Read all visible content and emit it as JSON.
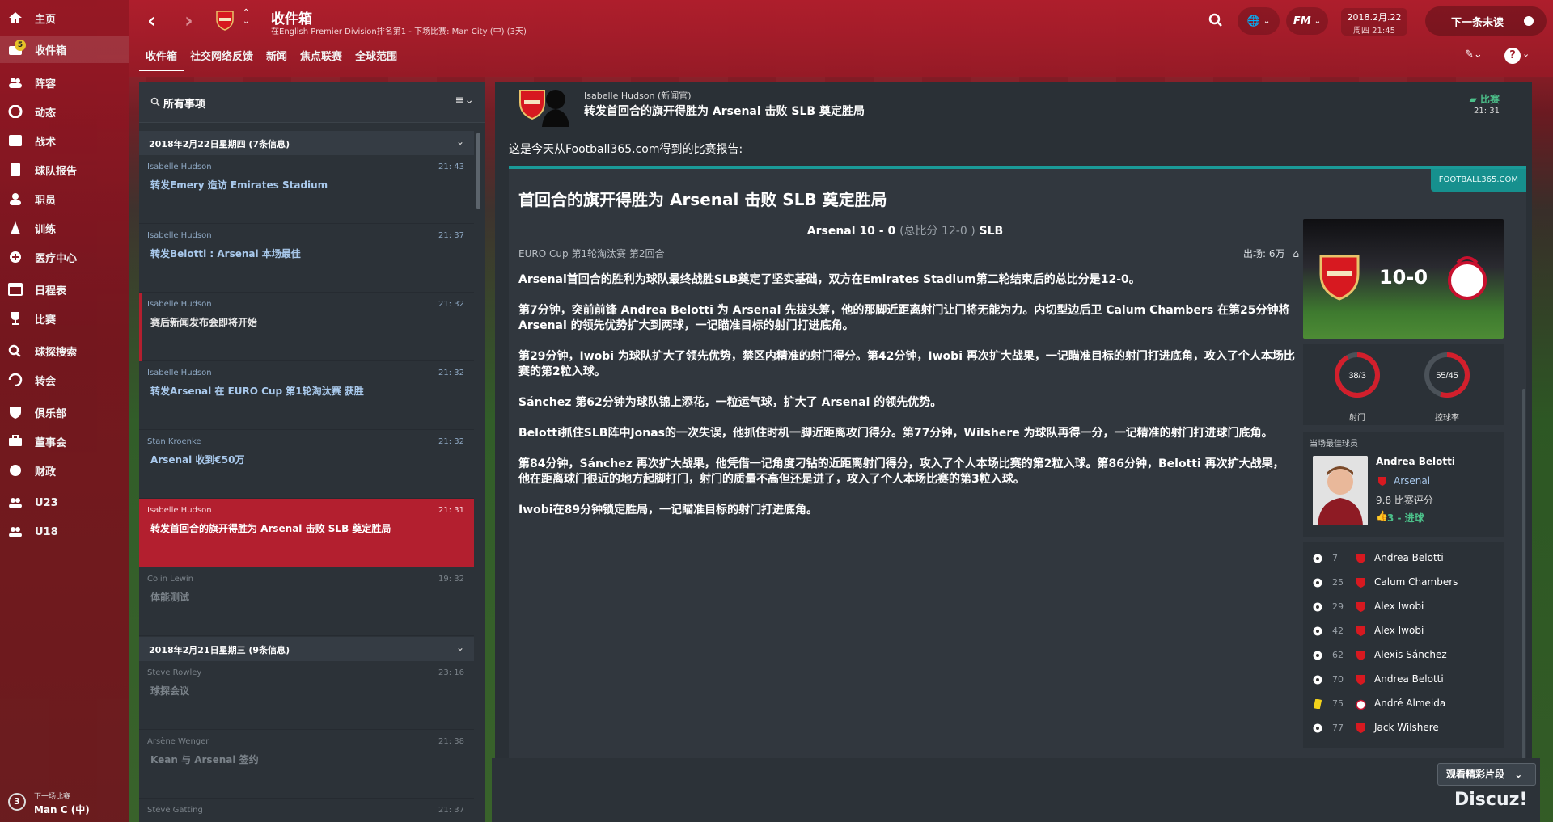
{
  "sidebar": {
    "items": [
      {
        "label": "主页",
        "icon": "home-icon"
      },
      {
        "label": "收件箱",
        "icon": "inbox-icon",
        "badge": "5"
      },
      {
        "label": "阵容",
        "icon": "squad-icon"
      },
      {
        "label": "动态",
        "icon": "dynamics-icon"
      },
      {
        "label": "战术",
        "icon": "tactics-icon"
      },
      {
        "label": "球队报告",
        "icon": "report-icon"
      },
      {
        "label": "职员",
        "icon": "staff-icon"
      },
      {
        "label": "训练",
        "icon": "training-icon"
      },
      {
        "label": "医疗中心",
        "icon": "medical-icon"
      },
      {
        "label": "日程表",
        "icon": "calendar-icon"
      },
      {
        "label": "比赛",
        "icon": "trophy-icon"
      },
      {
        "label": "球探搜索",
        "icon": "search-icon"
      },
      {
        "label": "转会",
        "icon": "transfer-icon"
      },
      {
        "label": "俱乐部",
        "icon": "club-icon"
      },
      {
        "label": "董事会",
        "icon": "board-icon"
      },
      {
        "label": "财政",
        "icon": "finance-icon"
      },
      {
        "label": "U23",
        "icon": "u23-icon"
      },
      {
        "label": "U18",
        "icon": "u18-icon"
      }
    ],
    "next_match": {
      "number": "3",
      "label": "下一场比赛",
      "value": "Man C (中)"
    }
  },
  "topbar": {
    "title": "收件箱",
    "subtitle": "在English Premier Division排名第1 - 下场比赛: Man City (中) (3天)",
    "tabs": [
      "收件箱",
      "社交网络反馈",
      "新闻",
      "焦点联赛",
      "全球范围"
    ],
    "date_line1": "2018.2月.22",
    "date_line2": "周四 21:45",
    "continue_label": "下一条未读",
    "fm_label": "FM"
  },
  "inbox": {
    "filter_title": "所有事项",
    "groups": [
      {
        "title": "2018年2月22日星期四 (7条信息)",
        "messages": [
          {
            "from": "Isabelle Hudson",
            "time": "21: 43",
            "subject": "转发Emery 造访 Emirates Stadium"
          },
          {
            "from": "Isabelle Hudson",
            "time": "21: 37",
            "subject": "转发Belotti : Arsenal 本场最佳"
          },
          {
            "from": "Isabelle Hudson",
            "time": "21: 32",
            "subject": "赛后新闻发布会即将开始"
          },
          {
            "from": "Isabelle Hudson",
            "time": "21: 32",
            "subject": "转发Arsenal 在 EURO Cup 第1轮淘汰赛 获胜"
          },
          {
            "from": "Stan Kroenke",
            "time": "21: 32",
            "subject": "Arsenal 收到€50万"
          },
          {
            "from": "Isabelle Hudson",
            "time": "21: 31",
            "subject": "转发首回合的旗开得胜为 Arsenal 击败 SLB 奠定胜局"
          },
          {
            "from": "Colin Lewin",
            "time": "19: 32",
            "subject": "体能测试"
          }
        ]
      },
      {
        "title": "2018年2月21日星期三 (9条信息)",
        "messages": [
          {
            "from": "Steve Rowley",
            "time": "23: 16",
            "subject": "球探会议"
          },
          {
            "from": "Arsène Wenger",
            "time": "21: 38",
            "subject": "Kean 与 Arsenal 签约"
          },
          {
            "from": "Steve Gatting",
            "time": "21: 37",
            "subject": ""
          }
        ]
      }
    ]
  },
  "message": {
    "from": "Isabelle Hudson (新闻官)",
    "subject": "转发首回合的旗开得胜为 Arsenal 击败 SLB 奠定胜局",
    "tag": "比赛",
    "time": "21: 31",
    "intro": "这是今天从Football365.com得到的比赛报告:"
  },
  "report": {
    "source": "FOOTBALL365.COM",
    "title": "首回合的旗开得胜为 Arsenal 击败 SLB 奠定胜局",
    "score_main": "Arsenal 10 - 0 ",
    "score_agg": "(总比分 12-0 )",
    "score_away": " SLB",
    "competition": "EURO Cup 第1轮淘汰赛 第2回合",
    "attendance": "出场: 6万",
    "paragraphs": [
      "Arsenal首回合的胜利为球队最终战胜SLB奠定了坚实基础，双方在Emirates Stadium第二轮结束后的总比分是12-0。",
      "第7分钟，突前前锋 Andrea Belotti 为 Arsenal 先拔头筹，他的那脚近距离射门让门将无能为力。内切型边后卫 Calum Chambers 在第25分钟将 Arsenal 的领先优势扩大到两球，一记瞄准目标的射门打进底角。",
      "第29分钟，Iwobi 为球队扩大了领先优势，禁区内精准的射门得分。第42分钟，Iwobi 再次扩大战果，一记瞄准目标的射门打进底角，攻入了个人本场比赛的第2粒入球。",
      "Sánchez 第62分钟为球队锦上添花，一粒运气球，扩大了 Arsenal 的领先优势。",
      "Belotti抓住SLB阵中Jonas的一次失误，他抓住时机一脚近距离攻门得分。第77分钟，Wilshere 为球队再得一分，一记精准的射门打进球门底角。",
      "第84分钟，Sánchez 再次扩大战果，他凭借一记角度刁钻的近距离射门得分，攻入了个人本场比赛的第2粒入球。第86分钟，Belotti 再次扩大战果，他在距离球门很近的地方起脚打门，射门的质量不高但还是进了，攻入了个人本场比赛的第3粒入球。",
      "Iwobi在89分钟锁定胜局，一记瞄准目标的射门打进底角。"
    ],
    "image_score": "10-0",
    "stats": [
      {
        "value": "38/3",
        "label": "射门",
        "fraction": 0.92
      },
      {
        "value": "55/45",
        "label": "控球率",
        "fraction": 0.55
      }
    ],
    "motm": {
      "heading": "当场最佳球员",
      "name": "Andrea Belotti",
      "club": "Arsenal",
      "rating": "9.8 比赛评分",
      "goals": "3 - 进球"
    },
    "events": [
      {
        "minute": "7",
        "player": "Andrea Belotti",
        "type": "goal",
        "team": "arsenal"
      },
      {
        "minute": "25",
        "player": "Calum Chambers",
        "type": "goal",
        "team": "arsenal"
      },
      {
        "minute": "29",
        "player": "Alex Iwobi",
        "type": "goal",
        "team": "arsenal"
      },
      {
        "minute": "42",
        "player": "Alex Iwobi",
        "type": "goal",
        "team": "arsenal"
      },
      {
        "minute": "62",
        "player": "Alexis Sánchez",
        "type": "goal",
        "team": "arsenal"
      },
      {
        "minute": "70",
        "player": "Andrea Belotti",
        "type": "goal",
        "team": "arsenal"
      },
      {
        "minute": "75",
        "player": "André Almeida",
        "type": "yellow-card",
        "team": "benfica"
      },
      {
        "minute": "77",
        "player": "Jack Wilshere",
        "type": "goal",
        "team": "arsenal"
      }
    ]
  },
  "footer": {
    "highlights_label": "观看精彩片段",
    "watermark": "Discuz!"
  },
  "colors": {
    "accent_red": "#b31f2f",
    "link_blue": "#a9c9ec",
    "positive_green": "#4cc08a",
    "source_teal": "#16908e"
  }
}
